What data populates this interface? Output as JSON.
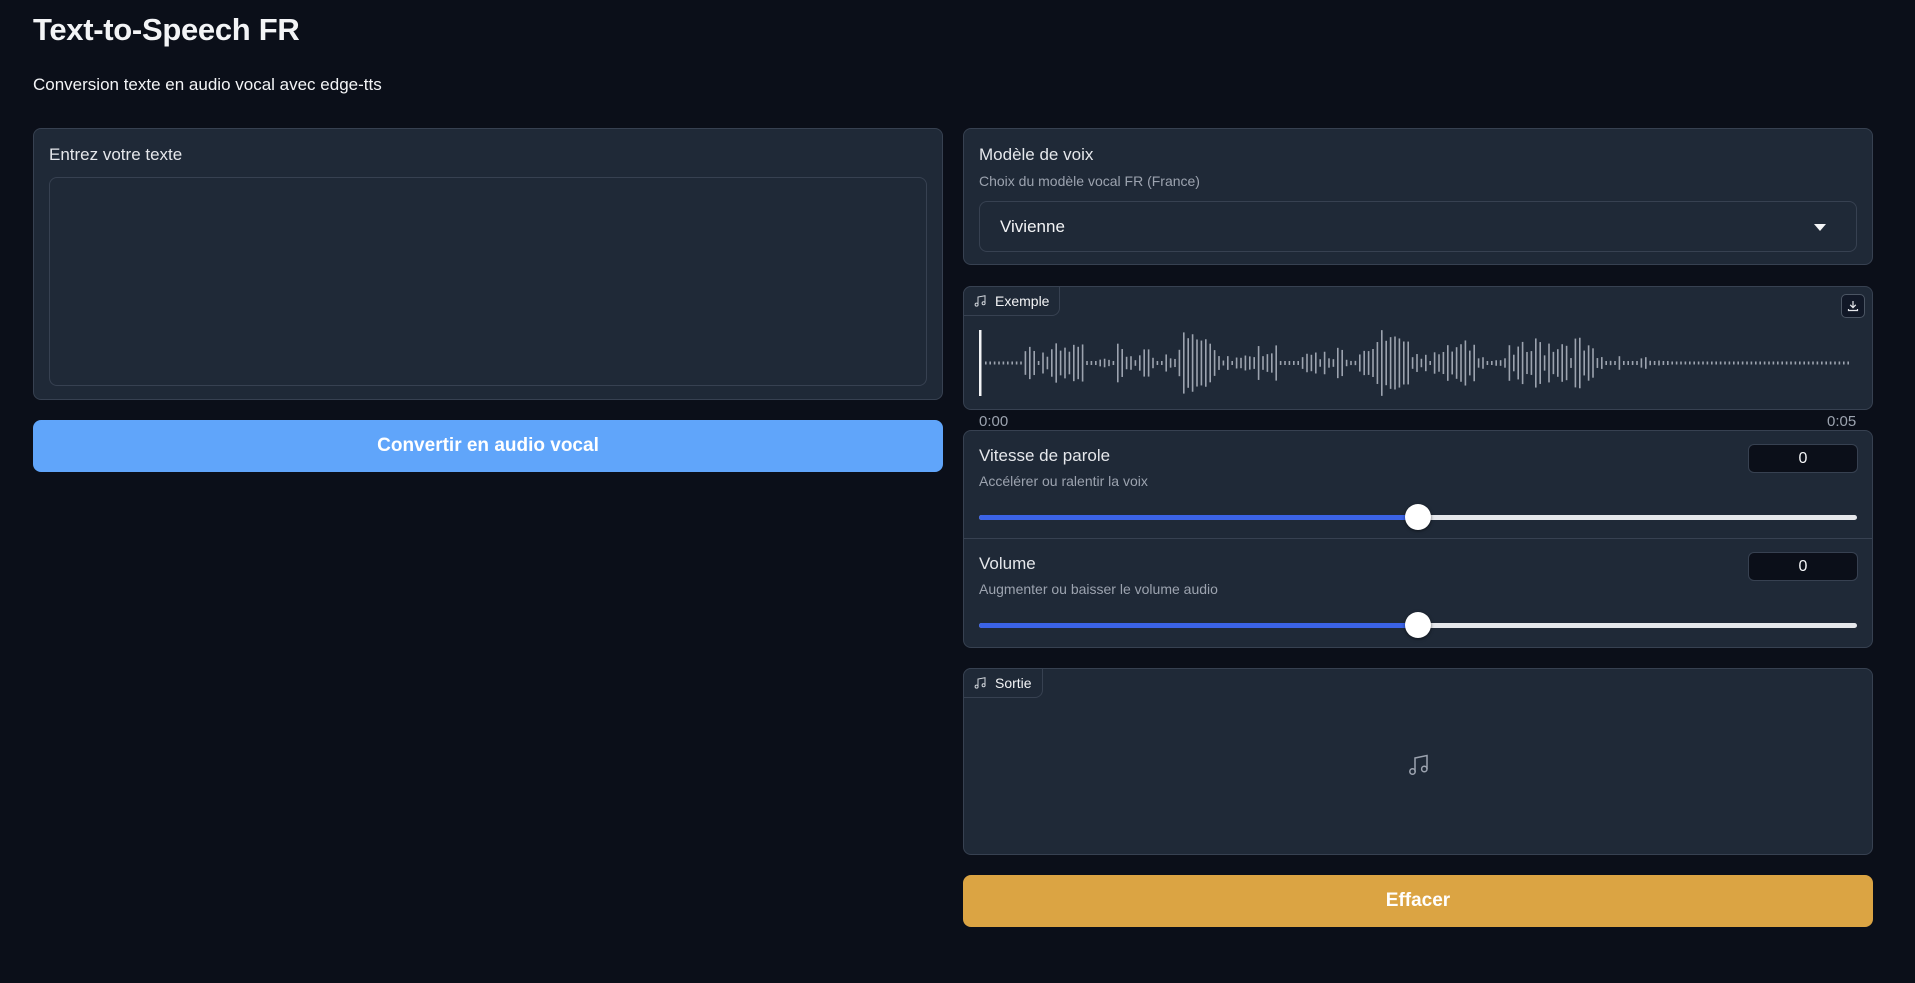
{
  "header": {
    "title": "Text-to-Speech FR",
    "subtitle": "Conversion texte en audio vocal avec edge-tts"
  },
  "text_input": {
    "label": "Entrez votre texte",
    "value": ""
  },
  "convert_button": {
    "label": "Convertir en audio vocal",
    "color": "#60a5fa"
  },
  "voice_model": {
    "label": "Modèle de voix",
    "info": "Choix du modèle vocal FR (France)",
    "selected": "Vivienne"
  },
  "example_audio": {
    "label": "Exemple",
    "icon": "music-note-icon",
    "time_start": "0:00",
    "time_end": "0:05",
    "download_icon": "download-icon"
  },
  "speed": {
    "label": "Vitesse de parole",
    "info": "Accélérer ou ralentir la voix",
    "value": "0",
    "fraction": 0.5
  },
  "volume": {
    "label": "Volume",
    "info": "Augmenter ou baisser le volume audio",
    "value": "0",
    "fraction": 0.5
  },
  "output_audio": {
    "label": "Sortie",
    "icon": "music-note-icon"
  },
  "clear_button": {
    "label": "Effacer",
    "color": "#dba443"
  },
  "colors": {
    "background": "#0b0f19",
    "panel": "#1f2937",
    "slider_fill": "#3b63e6"
  }
}
